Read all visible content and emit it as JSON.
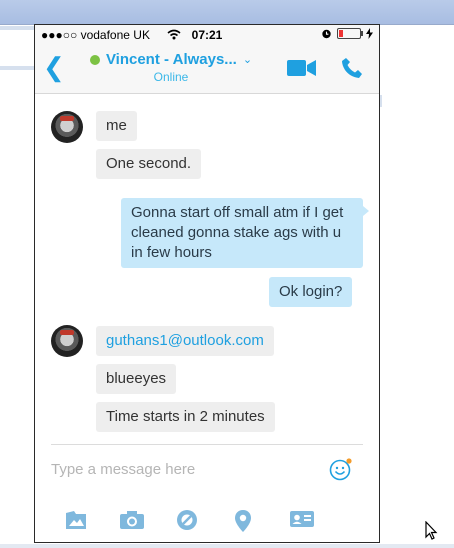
{
  "status_bar": {
    "carrier": "●●●○○ vodafone UK",
    "time": "07:21"
  },
  "header": {
    "title": "Vincent - Always...",
    "subtitle": "Online"
  },
  "messages": [
    {
      "from": "them",
      "text": "me"
    },
    {
      "from": "them",
      "text": "One second."
    },
    {
      "from": "me",
      "text": "Gonna start off small atm if I get cleaned gonna stake ags with u in few hours"
    },
    {
      "from": "me",
      "text": "Ok login?"
    },
    {
      "from": "them",
      "text": "guthans1@outlook.com"
    },
    {
      "from": "them",
      "text": "blueeyes"
    },
    {
      "from": "them",
      "text": "Time starts in 2 minutes"
    }
  ],
  "composer": {
    "placeholder": "Type a message here"
  },
  "toolbar": [
    "media-icon",
    "camera-icon",
    "video-message-icon",
    "location-icon",
    "contact-card-icon"
  ],
  "colors": {
    "accent": "#1fa0e0",
    "presence": "#7cc243",
    "outgoing_bubble": "#c6e8fa",
    "incoming_bubble": "#eeeeee"
  }
}
